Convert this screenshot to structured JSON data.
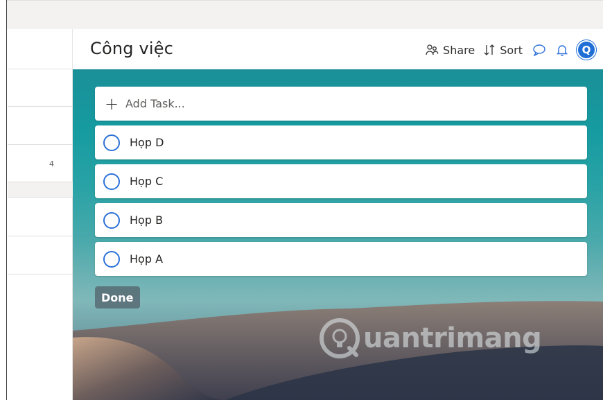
{
  "list": {
    "title": "Công việc",
    "left_count": "4"
  },
  "toolbar": {
    "share_label": "Share",
    "sort_label": "Sort",
    "avatar_initial": "Q"
  },
  "add_task": {
    "placeholder": "Add Task..."
  },
  "tasks": [
    {
      "title": "Họp D",
      "completed": false
    },
    {
      "title": "Họp C",
      "completed": false
    },
    {
      "title": "Họp B",
      "completed": false
    },
    {
      "title": "Họp A",
      "completed": false
    }
  ],
  "done_label": "Done",
  "watermark": {
    "text": "uantrimang"
  },
  "colors": {
    "accent": "#2b70d8",
    "avatar": "#1f6fd6"
  }
}
